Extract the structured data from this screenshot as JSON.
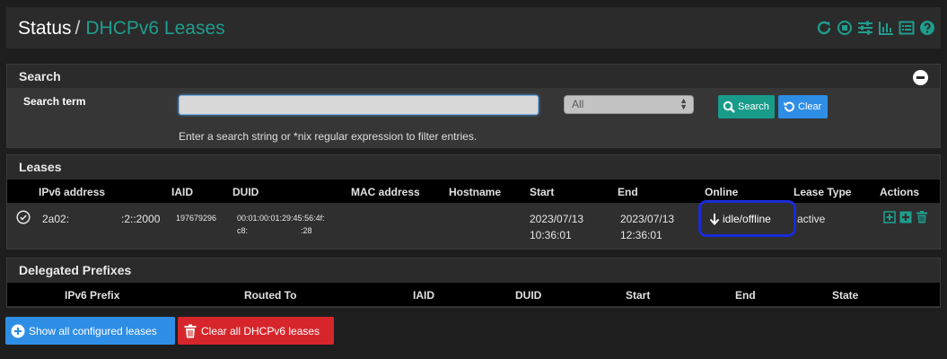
{
  "breadcrumb": {
    "section": "Status",
    "separator": "/",
    "page": "DHCPv6 Leases"
  },
  "header_icons": [
    "reload-icon",
    "stop-icon",
    "sliders-icon",
    "bar-chart-icon",
    "list-icon",
    "help-icon"
  ],
  "colors": {
    "accent": "#1f9d8e",
    "primary_blue": "#2e8ee6",
    "danger": "#d6262b",
    "highlight_border": "#1a2bd8"
  },
  "search": {
    "title": "Search",
    "term_label": "Search term",
    "input_value": "",
    "filter_selected": "All",
    "search_button": "Search",
    "clear_button": "Clear",
    "help_text": "Enter a search string or *nix regular expression to filter entries."
  },
  "leases": {
    "title": "Leases",
    "columns": [
      "IPv6 address",
      "IAID",
      "DUID",
      "MAC address",
      "Hostname",
      "Start",
      "End",
      "Online",
      "Lease Type",
      "Actions"
    ],
    "rows": [
      {
        "ipv6_a": "2a02:",
        "ipv6_b": ":2::2000",
        "iaid": "197679296",
        "duid_line1": "00:01:00:01:29:45:56:4f:",
        "duid_line2a": "c8:",
        "duid_line2b": ":28",
        "mac": "",
        "hostname": "",
        "start_date": "2023/07/13",
        "start_time": "10:36:01",
        "end_date": "2023/07/13",
        "end_time": "12:36:01",
        "online": "idle/offline",
        "lease_type": "active"
      }
    ]
  },
  "delegated": {
    "title": "Delegated Prefixes",
    "columns": [
      "IPv6 Prefix",
      "Routed To",
      "IAID",
      "DUID",
      "Start",
      "End",
      "State"
    ]
  },
  "bottom_buttons": {
    "show_all": "Show all configured leases",
    "clear_all": "Clear all DHCPv6 leases"
  }
}
